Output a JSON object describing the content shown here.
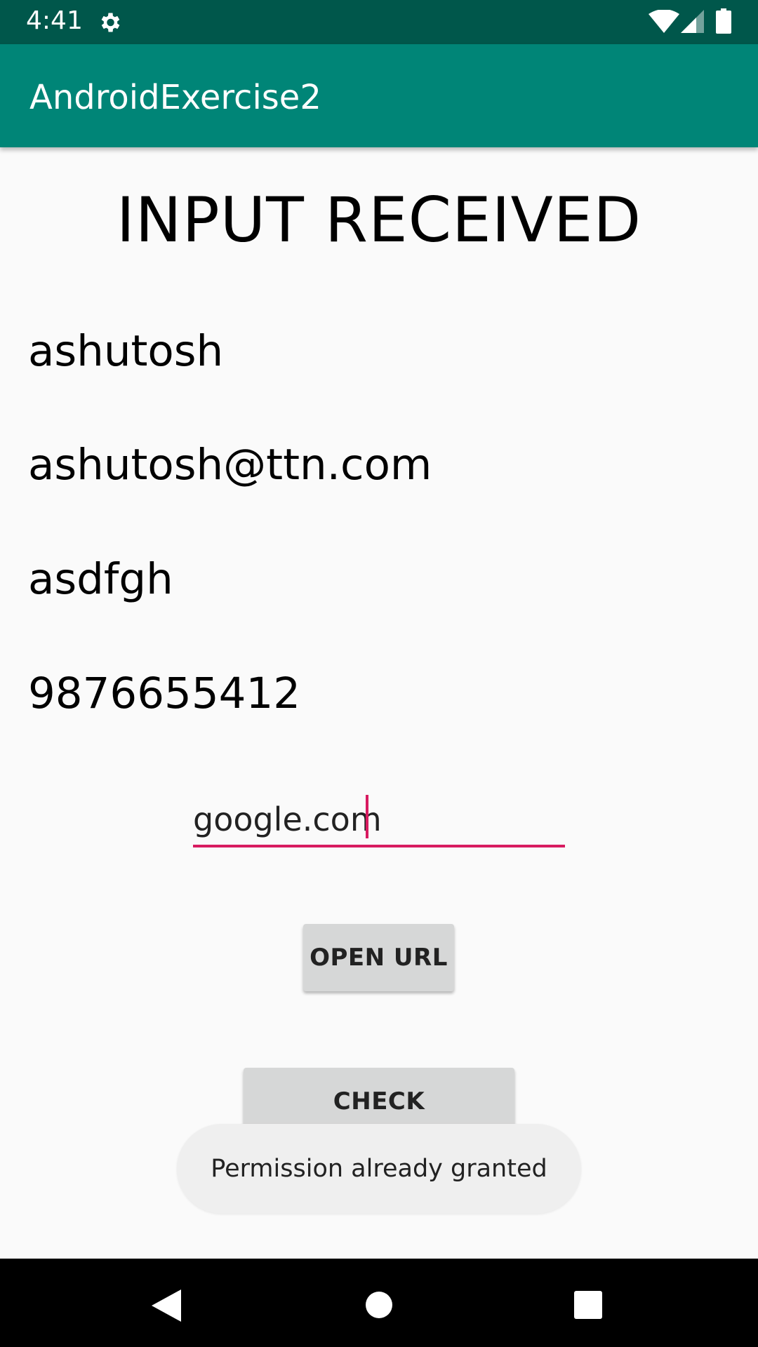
{
  "status_bar": {
    "time": "4:41",
    "icons": [
      "gear-icon",
      "wifi-icon",
      "signal-icon",
      "battery-icon"
    ]
  },
  "app_bar": {
    "title": "AndroidExercise2",
    "color": "#008577"
  },
  "main": {
    "heading": "INPUT RECEIVED",
    "values": [
      "ashutosh",
      "ashutosh@ttn.com",
      "asdfgh",
      "9876655412"
    ],
    "url_input": {
      "value": "google.com",
      "accent": "#d81b60"
    },
    "open_url_label": "OPEN URL",
    "check_permission_label": "CHECK PERMISSION"
  },
  "toast": {
    "message": "Permission already granted"
  },
  "nav_bar": {
    "icons": [
      "back-icon",
      "home-icon",
      "recents-icon"
    ]
  }
}
